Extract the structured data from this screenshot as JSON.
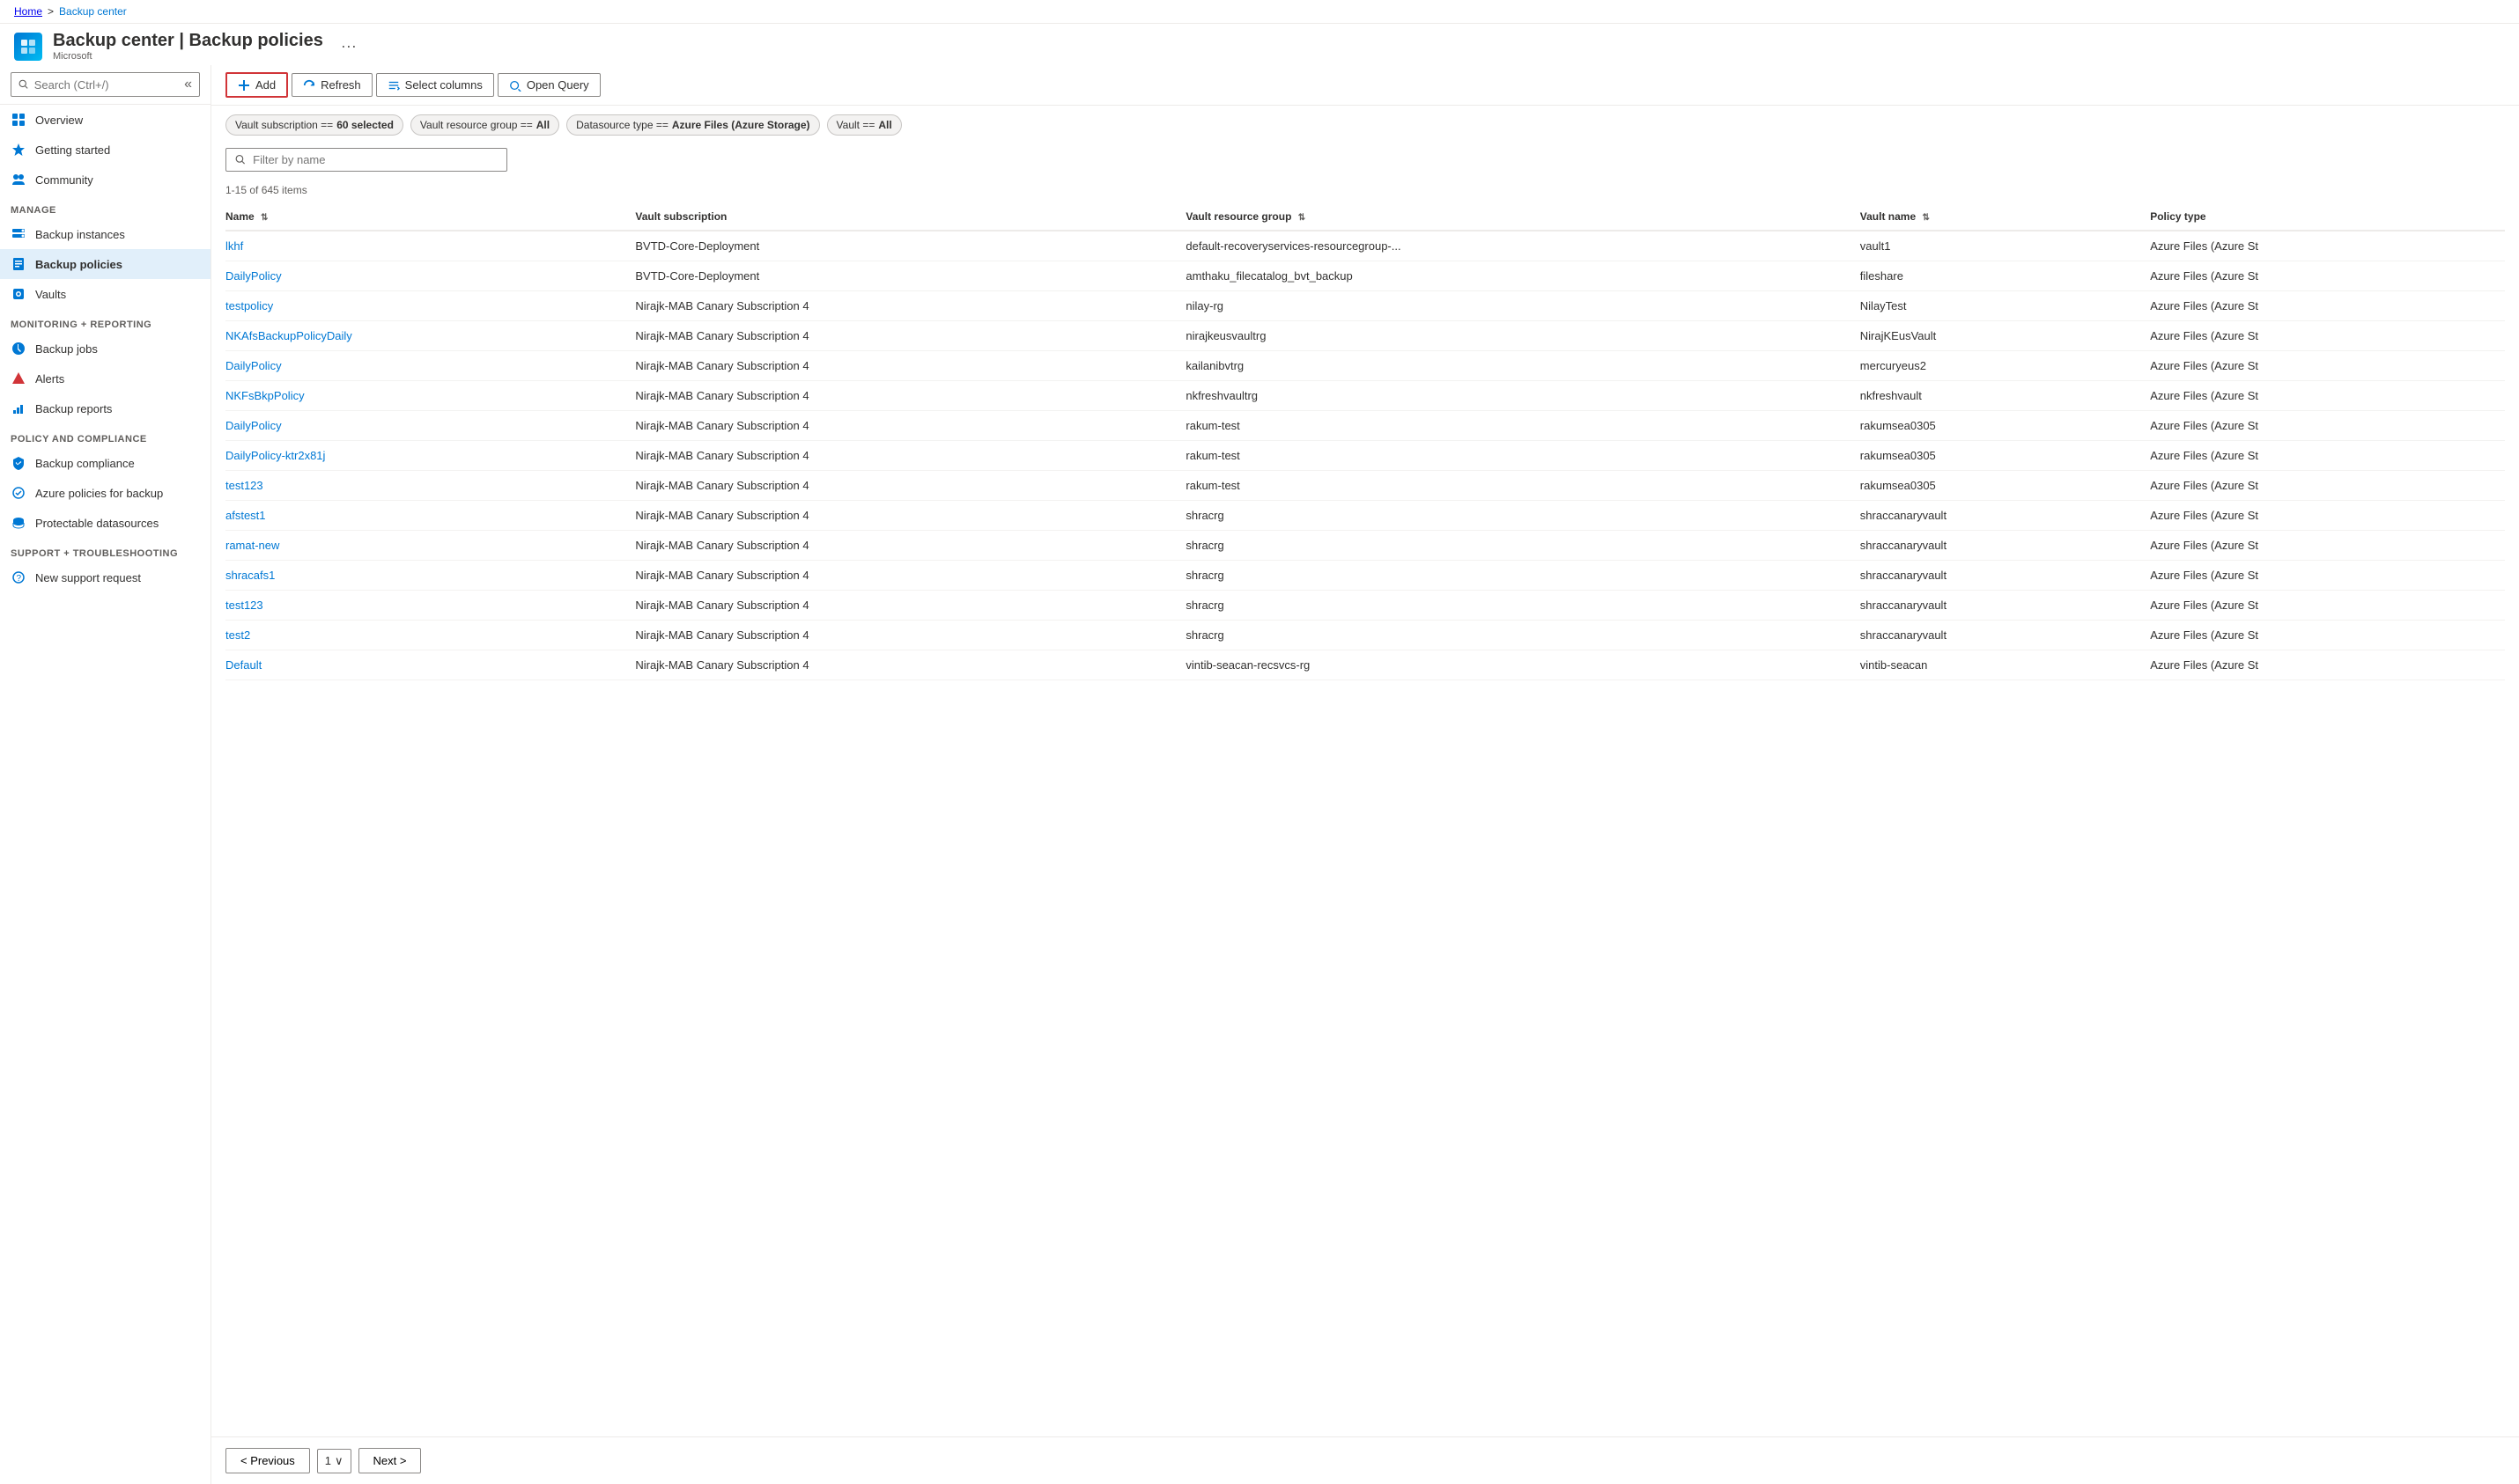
{
  "breadcrumb": {
    "home": "Home",
    "current": "Backup center"
  },
  "header": {
    "title": "Backup center | Backup policies",
    "subtitle": "Microsoft",
    "ellipsis": "···"
  },
  "sidebar": {
    "search_placeholder": "Search (Ctrl+/)",
    "collapse_label": "«",
    "items_nav": [
      {
        "id": "overview",
        "label": "Overview",
        "icon": "grid"
      },
      {
        "id": "getting-started",
        "label": "Getting started",
        "icon": "star"
      },
      {
        "id": "community",
        "label": "Community",
        "icon": "people"
      }
    ],
    "manage_label": "Manage",
    "items_manage": [
      {
        "id": "backup-instances",
        "label": "Backup instances",
        "icon": "db"
      },
      {
        "id": "backup-policies",
        "label": "Backup policies",
        "icon": "policy",
        "active": true
      },
      {
        "id": "vaults",
        "label": "Vaults",
        "icon": "vault"
      }
    ],
    "monitoring_label": "Monitoring + reporting",
    "items_monitoring": [
      {
        "id": "backup-jobs",
        "label": "Backup jobs",
        "icon": "jobs"
      },
      {
        "id": "alerts",
        "label": "Alerts",
        "icon": "alert"
      },
      {
        "id": "backup-reports",
        "label": "Backup reports",
        "icon": "report"
      }
    ],
    "policy_label": "Policy and compliance",
    "items_policy": [
      {
        "id": "backup-compliance",
        "label": "Backup compliance",
        "icon": "compliance"
      },
      {
        "id": "azure-policies",
        "label": "Azure policies for backup",
        "icon": "azpolicy"
      },
      {
        "id": "protectable-datasources",
        "label": "Protectable datasources",
        "icon": "datasource"
      }
    ],
    "support_label": "Support + troubleshooting",
    "items_support": [
      {
        "id": "new-support",
        "label": "New support request",
        "icon": "support"
      }
    ]
  },
  "toolbar": {
    "add_label": "Add",
    "refresh_label": "Refresh",
    "select_columns_label": "Select columns",
    "open_query_label": "Open Query"
  },
  "filters": [
    {
      "id": "vault-subscription",
      "text": "Vault subscription == ",
      "value": "60 selected"
    },
    {
      "id": "vault-resource-group",
      "text": "Vault resource group == ",
      "value": "All"
    },
    {
      "id": "datasource-type",
      "text": "Datasource type == ",
      "value": "Azure Files (Azure Storage)"
    },
    {
      "id": "vault",
      "text": "Vault == ",
      "value": "All"
    }
  ],
  "filter_input_placeholder": "Filter by name",
  "item_count": "1-15 of 645 items",
  "table": {
    "columns": [
      {
        "id": "name",
        "label": "Name",
        "sortable": true
      },
      {
        "id": "vault-subscription",
        "label": "Vault subscription",
        "sortable": false
      },
      {
        "id": "vault-resource-group",
        "label": "Vault resource group",
        "sortable": true
      },
      {
        "id": "vault-name",
        "label": "Vault name",
        "sortable": true
      },
      {
        "id": "policy-type",
        "label": "Policy type",
        "sortable": false
      }
    ],
    "rows": [
      {
        "name": "lkhf",
        "vault_subscription": "BVTD-Core-Deployment",
        "vault_resource_group": "default-recoveryservices-resourcegroup-...",
        "vault_name": "vault1",
        "policy_type": "Azure Files (Azure St"
      },
      {
        "name": "DailyPolicy",
        "vault_subscription": "BVTD-Core-Deployment",
        "vault_resource_group": "amthaku_filecatalog_bvt_backup",
        "vault_name": "fileshare",
        "policy_type": "Azure Files (Azure St"
      },
      {
        "name": "testpolicy",
        "vault_subscription": "Nirajk-MAB Canary Subscription 4",
        "vault_resource_group": "nilay-rg",
        "vault_name": "NilayTest",
        "policy_type": "Azure Files (Azure St"
      },
      {
        "name": "NKAfsBackupPolicyDaily",
        "vault_subscription": "Nirajk-MAB Canary Subscription 4",
        "vault_resource_group": "nirajkeusvaultrg",
        "vault_name": "NirajKEusVault",
        "policy_type": "Azure Files (Azure St"
      },
      {
        "name": "DailyPolicy",
        "vault_subscription": "Nirajk-MAB Canary Subscription 4",
        "vault_resource_group": "kailanibvtrg",
        "vault_name": "mercuryeus2",
        "policy_type": "Azure Files (Azure St"
      },
      {
        "name": "NKFsBkpPolicy",
        "vault_subscription": "Nirajk-MAB Canary Subscription 4",
        "vault_resource_group": "nkfreshvaultrg",
        "vault_name": "nkfreshvault",
        "policy_type": "Azure Files (Azure St"
      },
      {
        "name": "DailyPolicy",
        "vault_subscription": "Nirajk-MAB Canary Subscription 4",
        "vault_resource_group": "rakum-test",
        "vault_name": "rakumsea0305",
        "policy_type": "Azure Files (Azure St"
      },
      {
        "name": "DailyPolicy-ktr2x81j",
        "vault_subscription": "Nirajk-MAB Canary Subscription 4",
        "vault_resource_group": "rakum-test",
        "vault_name": "rakumsea0305",
        "policy_type": "Azure Files (Azure St"
      },
      {
        "name": "test123",
        "vault_subscription": "Nirajk-MAB Canary Subscription 4",
        "vault_resource_group": "rakum-test",
        "vault_name": "rakumsea0305",
        "policy_type": "Azure Files (Azure St"
      },
      {
        "name": "afstest1",
        "vault_subscription": "Nirajk-MAB Canary Subscription 4",
        "vault_resource_group": "shracrg",
        "vault_name": "shraccanaryvault",
        "policy_type": "Azure Files (Azure St"
      },
      {
        "name": "ramat-new",
        "vault_subscription": "Nirajk-MAB Canary Subscription 4",
        "vault_resource_group": "shracrg",
        "vault_name": "shraccanaryvault",
        "policy_type": "Azure Files (Azure St"
      },
      {
        "name": "shracafs1",
        "vault_subscription": "Nirajk-MAB Canary Subscription 4",
        "vault_resource_group": "shracrg",
        "vault_name": "shraccanaryvault",
        "policy_type": "Azure Files (Azure St"
      },
      {
        "name": "test123",
        "vault_subscription": "Nirajk-MAB Canary Subscription 4",
        "vault_resource_group": "shracrg",
        "vault_name": "shraccanaryvault",
        "policy_type": "Azure Files (Azure St"
      },
      {
        "name": "test2",
        "vault_subscription": "Nirajk-MAB Canary Subscription 4",
        "vault_resource_group": "shracrg",
        "vault_name": "shraccanaryvault",
        "policy_type": "Azure Files (Azure St"
      },
      {
        "name": "Default",
        "vault_subscription": "Nirajk-MAB Canary Subscription 4",
        "vault_resource_group": "vintib-seacan-recsvcs-rg",
        "vault_name": "vintib-seacan",
        "policy_type": "Azure Files (Azure St"
      }
    ]
  },
  "pagination": {
    "previous_label": "< Previous",
    "next_label": "Next >",
    "page": "1",
    "dropdown_icon": "∨"
  }
}
